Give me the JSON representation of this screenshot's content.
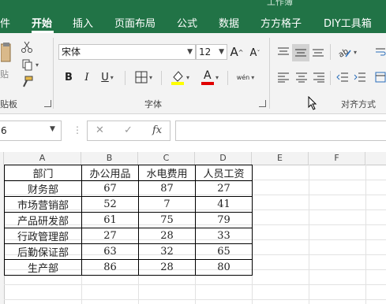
{
  "window": {
    "title": "工作簿"
  },
  "tabs": [
    "件",
    "开始",
    "插入",
    "页面布局",
    "公式",
    "数据",
    "方方格子",
    "DIY工具箱"
  ],
  "ribbon": {
    "clipboard": {
      "paste_label": "贴",
      "group_label": "贴板"
    },
    "font": {
      "name": "宋体",
      "size": "12",
      "grow": "A",
      "shrink": "A",
      "bold": "B",
      "italic": "I",
      "underline": "U",
      "font_color_letter": "A",
      "phonetic": "wén",
      "group_label": "字体"
    },
    "alignment": {
      "group_label": "对齐方式"
    }
  },
  "formula_bar": {
    "name_box": "6",
    "cancel": "✕",
    "enter": "✓",
    "fx": "fx",
    "value": ""
  },
  "columns": [
    "A",
    "B",
    "C",
    "D",
    "E",
    "F"
  ],
  "table": {
    "headers": [
      "部门",
      "办公用品",
      "水电费用",
      "人员工资"
    ],
    "rows": [
      [
        "财务部",
        "67",
        "87",
        "27"
      ],
      [
        "市场营销部",
        "52",
        "7",
        "41"
      ],
      [
        "产品研发部",
        "61",
        "75",
        "79"
      ],
      [
        "行政管理部",
        "27",
        "28",
        "33"
      ],
      [
        "后勤保证部",
        "63",
        "32",
        "65"
      ],
      [
        "生产部",
        "86",
        "28",
        "80"
      ]
    ]
  },
  "colors": {
    "accent": "#217346",
    "font_color_bar": "#e00000",
    "highlight_bar": "#ffff00"
  },
  "icons": [
    "scissors-icon",
    "copy-icon",
    "format-painter-icon",
    "borders-icon",
    "fill-color-icon",
    "font-color-icon",
    "align-top-icon",
    "align-middle-icon",
    "align-bottom-icon",
    "orientation-icon",
    "wrap-text-icon",
    "align-left-icon",
    "align-center-icon",
    "align-right-icon",
    "decrease-indent-icon",
    "increase-indent-icon",
    "merge-icon",
    "mouse-cursor-icon"
  ]
}
